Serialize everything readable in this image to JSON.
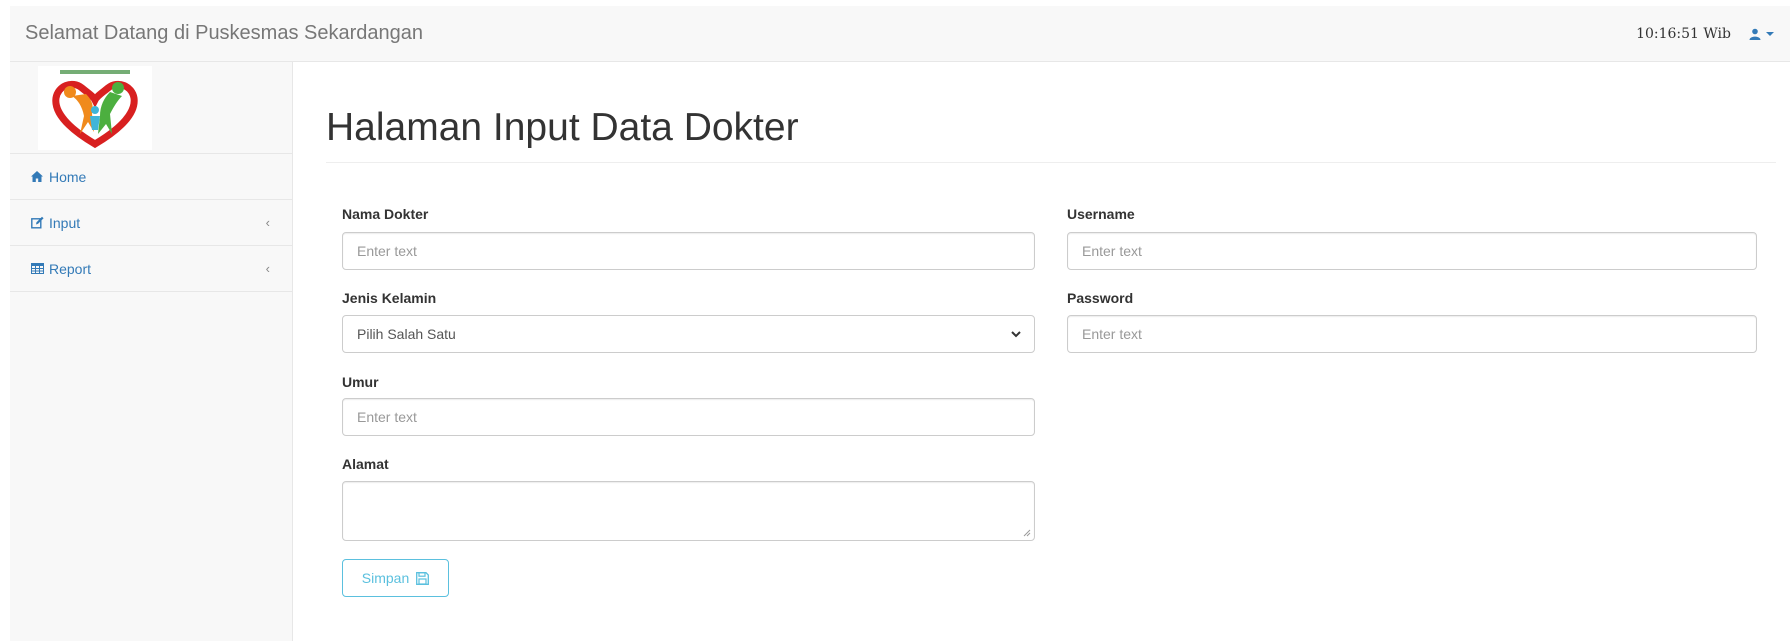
{
  "navbar": {
    "brand": "Selamat Datang di Puskesmas Sekardangan",
    "clock": "10:16:51 Wib",
    "user_icon": "user-icon"
  },
  "sidebar": {
    "logo_icon": "puskesmas-logo",
    "items": [
      {
        "label": "Home",
        "icon": "home-icon"
      },
      {
        "label": "Input",
        "icon": "edit-icon",
        "has_submenu": true
      },
      {
        "label": "Report",
        "icon": "table-icon",
        "has_submenu": true
      }
    ]
  },
  "page": {
    "title": "Halaman Input Data Dokter"
  },
  "form": {
    "nama_dokter": {
      "label": "Nama Dokter",
      "placeholder": "Enter text",
      "value": ""
    },
    "jenis_kelamin": {
      "label": "Jenis Kelamin",
      "selected": "Pilih Salah Satu"
    },
    "umur": {
      "label": "Umur",
      "placeholder": "Enter text",
      "value": ""
    },
    "alamat": {
      "label": "Alamat",
      "value": ""
    },
    "username": {
      "label": "Username",
      "placeholder": "Enter text",
      "value": ""
    },
    "password": {
      "label": "Password",
      "placeholder": "Enter text",
      "value": ""
    },
    "save_label": "Simpan",
    "save_icon": "floppy-disk-icon"
  },
  "colors": {
    "link": "#337ab7",
    "info": "#5bc0de",
    "navbar_bg": "#f8f8f8"
  }
}
